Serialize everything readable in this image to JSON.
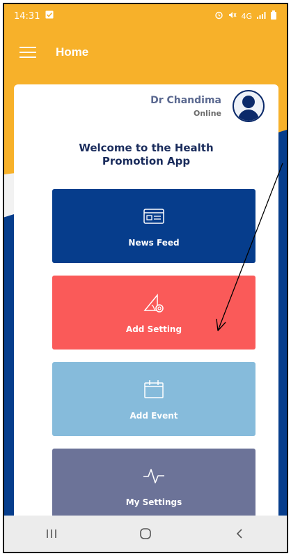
{
  "status_bar": {
    "time": "14:31",
    "network": "4G"
  },
  "header": {
    "title": "Home"
  },
  "user": {
    "name": "Dr Chandima",
    "status": "Online"
  },
  "welcome_text_line1": "Welcome to the Health",
  "welcome_text_line2": "Promotion App",
  "tiles": [
    {
      "label": "News Feed",
      "icon": "news-feed-icon",
      "color": "#063d8c"
    },
    {
      "label": "Add Setting",
      "icon": "add-setting-icon",
      "color": "#fa5a59"
    },
    {
      "label": "Add Event",
      "icon": "calendar-icon",
      "color": "#86bbdb"
    },
    {
      "label": "My Settings",
      "icon": "pulse-icon",
      "color": "#6c7398"
    }
  ],
  "colors": {
    "accent_yellow": "#f7b12a",
    "brand_blue": "#063d8c"
  }
}
